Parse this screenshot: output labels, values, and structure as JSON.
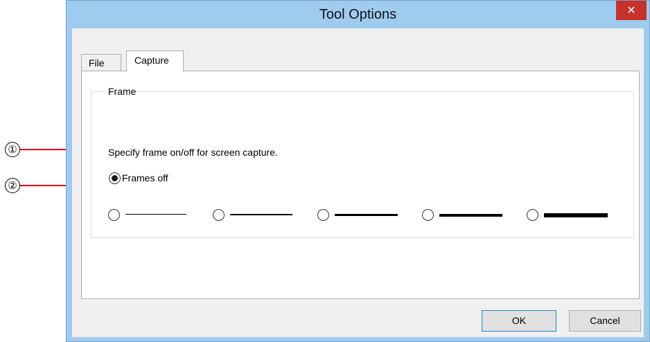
{
  "window": {
    "title": "Tool Options",
    "close_symbol": "✕"
  },
  "tabs": [
    {
      "label": "File",
      "selected": false
    },
    {
      "label": "Capture",
      "selected": true
    }
  ],
  "frame_group": {
    "legend": "Frame",
    "description": "Specify frame on/off for screen capture.",
    "frames_off_label": "Frames off",
    "frames_off_selected": true,
    "thickness_options_count": 5
  },
  "buttons": {
    "ok_label": "OK",
    "cancel_label": "Cancel"
  },
  "callouts": [
    "①",
    "②"
  ],
  "colors": {
    "callout_line": "#e4001b",
    "title_bar": "#9fcbef",
    "close_button": "#c7312b"
  }
}
